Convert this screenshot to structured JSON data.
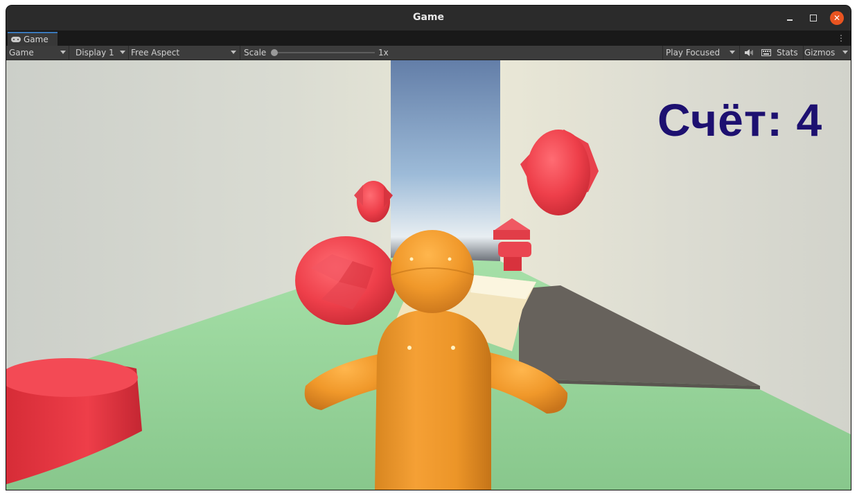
{
  "window": {
    "title": "Game"
  },
  "tab": {
    "label": "Game",
    "icon": "gamepad-icon"
  },
  "toolbar": {
    "view_mode": "Game",
    "display": "Display 1",
    "aspect": "Free Aspect",
    "scale_label": "Scale",
    "scale_value": "1x",
    "play_mode": "Play Focused",
    "stats": "Stats",
    "gizmos": "Gizmos"
  },
  "hud": {
    "score": "Счёт: 4"
  },
  "colors": {
    "title_bar": "#2b2b2b",
    "toolbar": "#3c3c3c",
    "tab_accent": "#3a79bb",
    "close_button": "#e95420",
    "score_text": "#1d1070",
    "player": "#f0982a",
    "collectible": "#f04850",
    "floor": "#8fcf95"
  }
}
